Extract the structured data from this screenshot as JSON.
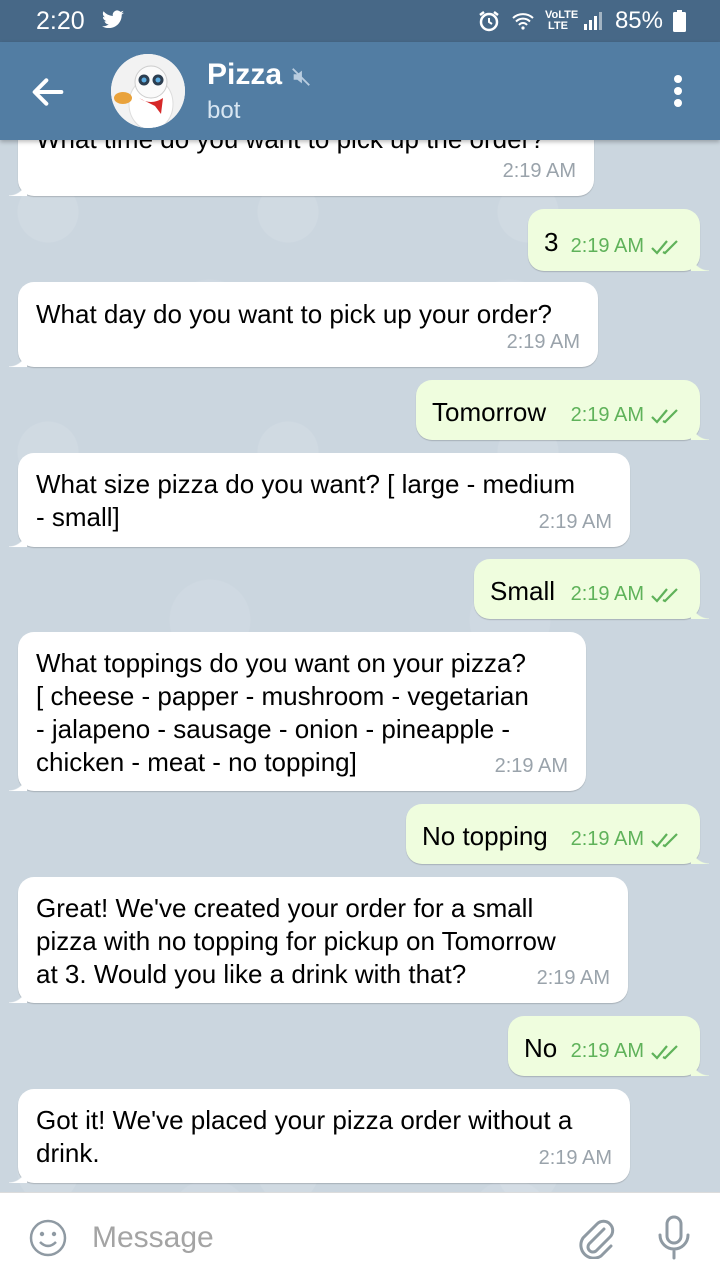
{
  "status_bar": {
    "time": "2:20",
    "network": "VoLTE LTE",
    "battery": "85%"
  },
  "header": {
    "title": "Pizza",
    "subtitle": "bot"
  },
  "messages": [
    {
      "text": "What time do you want to pick up the order?",
      "time": "2:19 AM",
      "direction": "in"
    },
    {
      "text": "3",
      "time": "2:19 AM",
      "direction": "out"
    },
    {
      "text": "What day do you want to pick up your order?",
      "time": "2:19 AM",
      "direction": "in"
    },
    {
      "text": "Tomorrow",
      "time": "2:19 AM",
      "direction": "out"
    },
    {
      "text": "What size pizza do you want? [ large - medium\n- small]",
      "time": "2:19 AM",
      "direction": "in"
    },
    {
      "text": "Small",
      "time": "2:19 AM",
      "direction": "out"
    },
    {
      "text": "What toppings do you want on your pizza?\n[ cheese - papper -  mushroom - vegetarian\n- jalapeno - sausage - onion - pineapple -\nchicken - meat -  no topping]",
      "time": "2:19 AM",
      "direction": "in"
    },
    {
      "text": "No topping",
      "time": "2:19 AM",
      "direction": "out"
    },
    {
      "text": "Great! We've created your order for a small\npizza with no topping for pickup on Tomorrow\nat 3. Would you like a drink with that?",
      "time": "2:19 AM",
      "direction": "in"
    },
    {
      "text": "No",
      "time": "2:19 AM",
      "direction": "out"
    },
    {
      "text": "Got it! We've placed your pizza order without a\ndrink.",
      "time": "2:19 AM",
      "direction": "in"
    }
  ],
  "input": {
    "placeholder": "Message"
  },
  "colors": {
    "status_bar": "#476887",
    "header": "#527da3",
    "incoming_bubble": "#ffffff",
    "outgoing_bubble": "#effdde",
    "read_check": "#5fb25a"
  }
}
